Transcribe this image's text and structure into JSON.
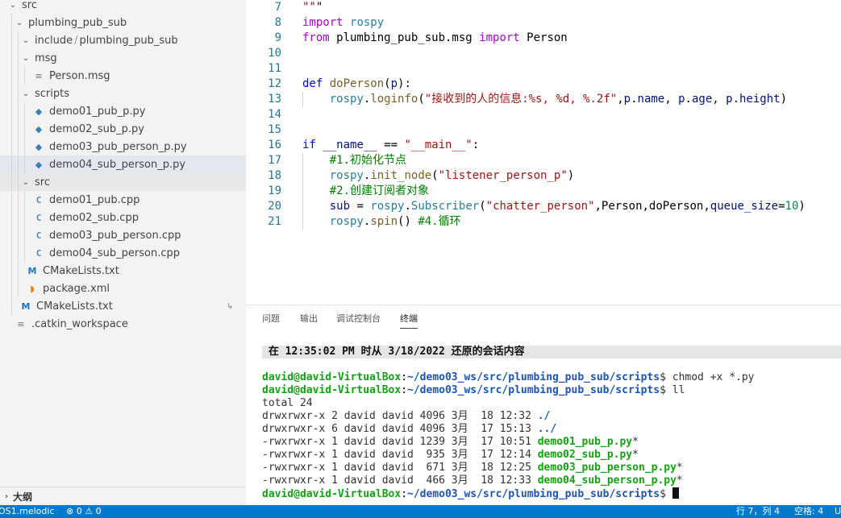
{
  "sidebar": {
    "tree": [
      {
        "label": "src",
        "level": 1,
        "kind": "folder-open"
      },
      {
        "label": "plumbing_pub_sub",
        "level": 2,
        "kind": "folder-open"
      },
      {
        "label": "include",
        "label2": "plumbing_pub_sub",
        "level": 3,
        "kind": "folder-open"
      },
      {
        "label": "msg",
        "level": 3,
        "kind": "folder-open"
      },
      {
        "label": "Person.msg",
        "level": 4,
        "kind": "lines"
      },
      {
        "label": "scripts",
        "level": 3,
        "kind": "folder-open"
      },
      {
        "label": "demo01_pub_p.py",
        "level": 4,
        "kind": "python"
      },
      {
        "label": "demo02_sub_p.py",
        "level": 4,
        "kind": "python"
      },
      {
        "label": "demo03_pub_person_p.py",
        "level": 4,
        "kind": "python"
      },
      {
        "label": "demo04_sub_person_p.py",
        "level": 4,
        "kind": "python",
        "selected": true
      },
      {
        "label": "src",
        "level": 3,
        "kind": "folder-open"
      },
      {
        "label": "demo01_pub.cpp",
        "level": 4,
        "kind": "cpp"
      },
      {
        "label": "demo02_sub.cpp",
        "level": 4,
        "kind": "cpp"
      },
      {
        "label": "demo03_pub_person.cpp",
        "level": 4,
        "kind": "cpp"
      },
      {
        "label": "demo04_sub_person.cpp",
        "level": 4,
        "kind": "cpp"
      },
      {
        "label": "CMakeLists.txt",
        "level": 3,
        "kind": "cmake"
      },
      {
        "label": "package.xml",
        "level": 3,
        "kind": "rss"
      },
      {
        "label": "CMakeLists.txt",
        "level": 2,
        "kind": "cmake"
      },
      {
        "label": ".catkin_workspace",
        "level": 1,
        "kind": "lines"
      }
    ],
    "outline_label": "大纲"
  },
  "editor": {
    "lines": [
      {
        "n": "7",
        "text": "\"\"\""
      },
      {
        "n": "8",
        "text": "import rospy"
      },
      {
        "n": "9",
        "text": "from plumbing_pub_sub.msg import Person"
      },
      {
        "n": "10",
        "text": ""
      },
      {
        "n": "11",
        "text": ""
      },
      {
        "n": "12",
        "text": "def doPerson(p):"
      },
      {
        "n": "13",
        "text": "    rospy.loginfo(\"接收到的人的信息:%s, %d, %.2f\",p.name, p.age, p.height)"
      },
      {
        "n": "14",
        "text": ""
      },
      {
        "n": "15",
        "text": ""
      },
      {
        "n": "16",
        "text": "if __name__ == \"__main__\":"
      },
      {
        "n": "17",
        "text": "    #1.初始化节点"
      },
      {
        "n": "18",
        "text": "    rospy.init_node(\"listener_person_p\")"
      },
      {
        "n": "19",
        "text": "    #2.创建订阅者对象"
      },
      {
        "n": "20",
        "text": "    sub = rospy.Subscriber(\"chatter_person\",Person,doPerson,queue_size=10)"
      },
      {
        "n": "21",
        "text": "    rospy.spin() #4.循环"
      }
    ]
  },
  "panel": {
    "tabs": [
      "问题",
      "输出",
      "调试控制台",
      "终端"
    ],
    "active_tab": "终端",
    "terminal": {
      "restore_banner": " 在 12:35:02 PM 时从 3/18/2022 还原的会话内容",
      "prompt_user": "david@david-VirtualBox",
      "prompt_path": "~/demo03_ws/src/plumbing_pub_sub/scripts",
      "cmd1": "chmod +x *.py",
      "cmd2": "ll",
      "total": "total 24",
      "listing": [
        {
          "meta": "drwxrwxr-x 2 david david 4096 3月  18 12:32 ",
          "name": "./",
          "suffix": "",
          "kind": "dir"
        },
        {
          "meta": "drwxrwxr-x 6 david david 4096 3月  17 15:13 ",
          "name": "../",
          "suffix": "",
          "kind": "dir"
        },
        {
          "meta": "-rwxrwxr-x 1 david david 1239 3月  17 10:51 ",
          "name": "demo01_pub_p.py",
          "suffix": "*",
          "kind": "exe"
        },
        {
          "meta": "-rwxrwxr-x 1 david david  935 3月  17 12:14 ",
          "name": "demo02_sub_p.py",
          "suffix": "*",
          "kind": "exe"
        },
        {
          "meta": "-rwxrwxr-x 1 david david  671 3月  18 12:25 ",
          "name": "demo03_pub_person_p.py",
          "suffix": "*",
          "kind": "exe"
        },
        {
          "meta": "-rwxrwxr-x 1 david david  466 3月  18 12:33 ",
          "name": "demo04_sub_person_p.py",
          "suffix": "*",
          "kind": "exe"
        }
      ]
    }
  },
  "statusbar": {
    "env": "OS1.melodic",
    "errors": "0",
    "warnings": "0",
    "position": "行 7，列 4",
    "spaces": "空格: 4",
    "encoding": "U"
  },
  "colors": {
    "statusbar_bg": "#007acc",
    "selected_row_bg": "#e4e6f1",
    "terminal_prompt": "#12a312",
    "terminal_path": "#1c55b7"
  }
}
